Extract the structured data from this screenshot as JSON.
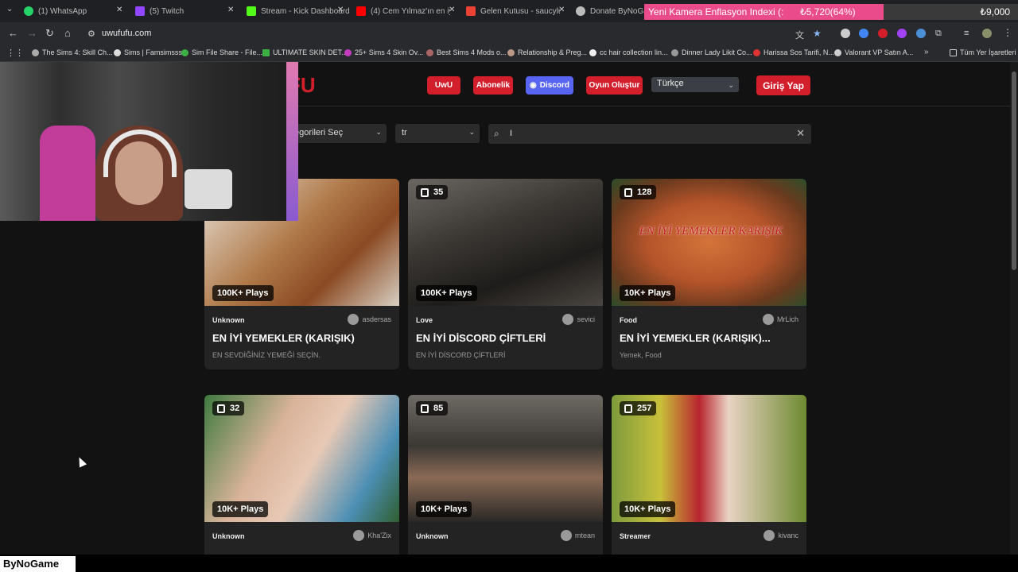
{
  "browser_tabs": [
    {
      "label": "(1) WhatsApp",
      "color": "#25d366"
    },
    {
      "label": "(5) Twitch",
      "color": "#9146ff"
    },
    {
      "label": "Stream - Kick Dashboard",
      "color": "#53fc18"
    },
    {
      "label": "(4) Cem Yılmaz'ın en iyi sk",
      "color": "#ff0000"
    },
    {
      "label": "Gelen Kutusu - saucyluna",
      "color": "#ea4335"
    },
    {
      "label": "Donate ByNoGame",
      "color": "#bbbbbb"
    }
  ],
  "stream_overlay": {
    "title": "Yeni Kamera Enflasyon Indexi (:",
    "value": "₺5,720(64%)",
    "goal": "₺9,000",
    "progress": 0.64
  },
  "address_bar": {
    "url": "uwufufu.com"
  },
  "bookmarks": [
    "The Sims 4: Skill Ch...",
    "Sims | Famsimsss",
    "Sim File Share - File...",
    "ULTIMATE SKIN DET...",
    "25+ Sims 4 Skin Ov...",
    "Best Sims 4 Mods o...",
    "Relationship & Preg...",
    "cc hair collection lin...",
    "Dinner Lady Likit Co...",
    "Harissa Sos Tarifi, N...",
    "Valorant VP Satın A...",
    "Tüm Yer İşaretleri"
  ],
  "site": {
    "logo_text": "FU",
    "nav": [
      "UwU",
      "Abonelik",
      "Discord",
      "Oyun Oluştur"
    ],
    "language": "Türkçe",
    "login": "Giriş Yap",
    "category_select": "egorileri Seç",
    "locale_select": "tr",
    "search_value": "I"
  },
  "cards": [
    {
      "count": "",
      "plays": "100K+ Plays",
      "category": "Unknown",
      "author": "asdersas",
      "title": "EN İYİ YEMEKLER (KARIŞIK)",
      "description": "EN SEVDİĞİNİZ YEMEĞİ SEÇİN.",
      "thumb_color": "#8a6b4f"
    },
    {
      "count": "35",
      "plays": "100K+ Plays",
      "category": "Love",
      "author": "sevici",
      "title": "EN İYİ DİSCORD ÇİFTLERİ",
      "description": "EN İYİ DİSCORD ÇİFTLERİ",
      "thumb_color": "#3d3a36"
    },
    {
      "count": "128",
      "plays": "10K+ Plays",
      "category": "Food",
      "author": "MrLich",
      "title": "EN İYİ YEMEKLER (KARIŞIK)...",
      "description": "Yemek, Food",
      "thumb_color": "#b5542a",
      "overlay_text": "EN İYİ YEMEKLER KARIŞIK"
    },
    {
      "count": "32",
      "plays": "10K+ Plays",
      "category": "Unknown",
      "author": "Kha'Zix",
      "title": "",
      "description": "",
      "thumb_color": "#c9a98d"
    },
    {
      "count": "85",
      "plays": "10K+ Plays",
      "category": "Unknown",
      "author": "mtean",
      "title": "",
      "description": "",
      "thumb_color": "#5a5550"
    },
    {
      "count": "257",
      "plays": "10K+ Plays",
      "category": "Streamer",
      "author": "kivanc",
      "title": "",
      "description": "",
      "thumb_color": "#7e9b3e"
    }
  ],
  "watermark": "ByNoGame",
  "colors": {
    "brand_red": "#d31f2b",
    "discord": "#5865f2",
    "overlay_pink": "#e94b8b"
  }
}
